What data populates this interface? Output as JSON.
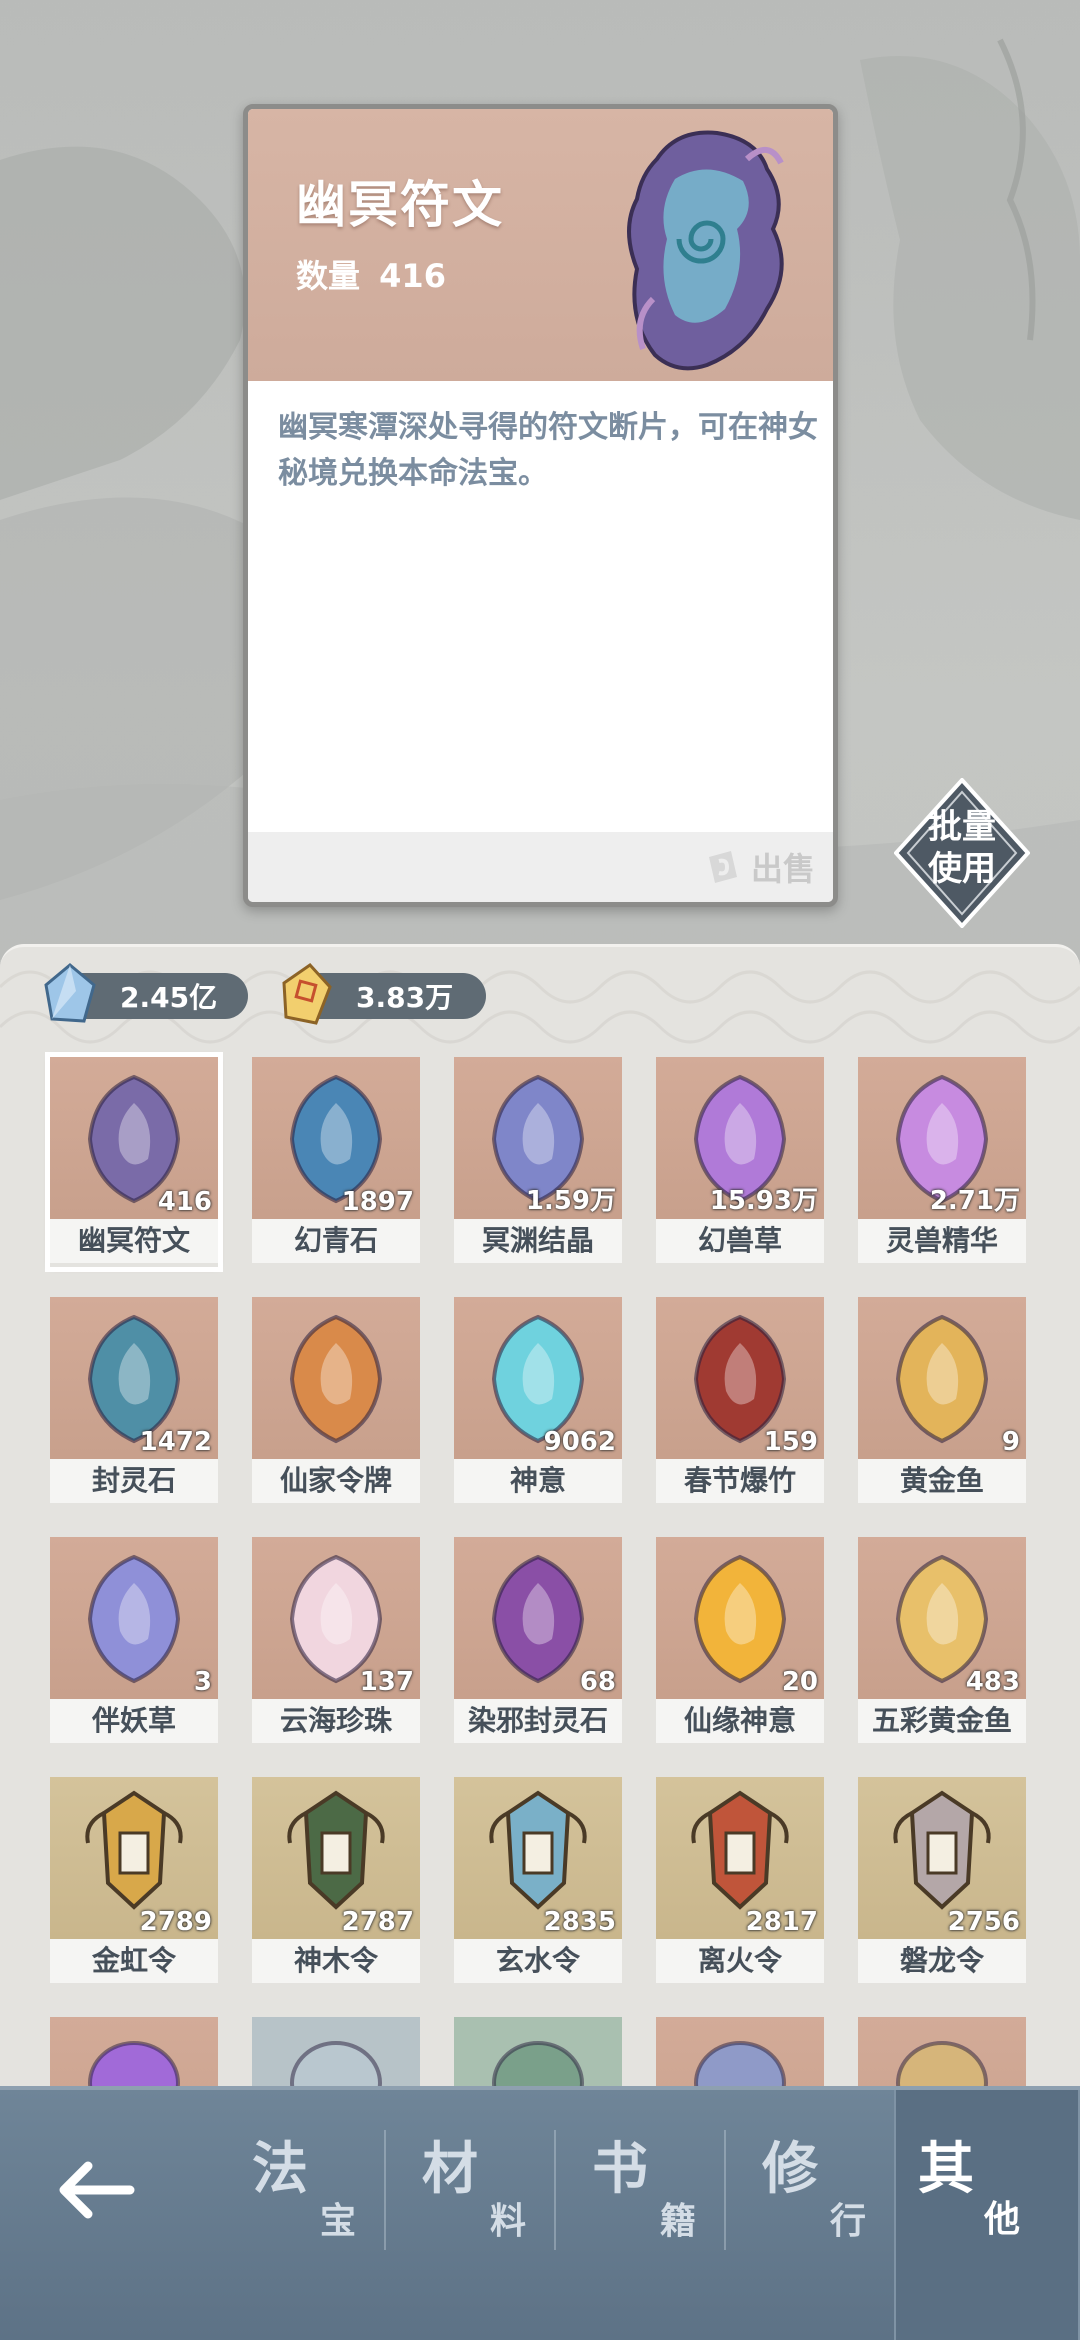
{
  "detail": {
    "title": "幽冥符文",
    "qty_label": "数量",
    "qty_value": "416",
    "description": "幽冥寒潭深处寻得的符文断片，可在神女秘境兑换本命法宝。",
    "sell_label": "出售"
  },
  "batch_use": {
    "line1": "批量",
    "line2": "使用"
  },
  "currency": [
    {
      "icon": "blue-crystal-icon",
      "value": "2.45亿"
    },
    {
      "icon": "gold-crystal-icon",
      "value": "3.83万"
    }
  ],
  "items": [
    {
      "name": "幽冥符文",
      "count": "416",
      "icon": "dark-rune-icon",
      "color": "#7a6ba8",
      "bg": "rose"
    },
    {
      "name": "幻青石",
      "count": "1897",
      "icon": "blue-stone-icon",
      "color": "#4a86b5",
      "bg": "rose"
    },
    {
      "name": "冥渊结晶",
      "count": "1.59万",
      "icon": "crystal-shard-icon",
      "color": "#7f86c9",
      "bg": "rose"
    },
    {
      "name": "幻兽草",
      "count": "15.93万",
      "icon": "purple-herb-icon",
      "color": "#b07ad8",
      "bg": "rose"
    },
    {
      "name": "灵兽精华",
      "count": "2.71万",
      "icon": "purple-orb-icon",
      "color": "#c78be0",
      "bg": "rose"
    },
    {
      "name": "封灵石",
      "count": "1472",
      "icon": "sealed-stone-icon",
      "color": "#4f8fa6",
      "bg": "rose"
    },
    {
      "name": "仙家令牌",
      "count": "",
      "icon": "fairy-token-icon",
      "color": "#d98a4a",
      "bg": "rose"
    },
    {
      "name": "神意",
      "count": "9062",
      "icon": "cyan-flame-icon",
      "color": "#6fd2de",
      "bg": "rose"
    },
    {
      "name": "春节爆竹",
      "count": "159",
      "icon": "firecracker-icon",
      "color": "#a03a32",
      "bg": "rose"
    },
    {
      "name": "黄金鱼",
      "count": "9",
      "icon": "golden-fish-icon",
      "color": "#e3b45a",
      "bg": "rose"
    },
    {
      "name": "伴妖草",
      "count": "3",
      "icon": "blue-herb-icon",
      "color": "#8f90d8",
      "bg": "rose"
    },
    {
      "name": "云海珍珠",
      "count": "137",
      "icon": "pearl-icon",
      "color": "#f1d6df",
      "bg": "rose"
    },
    {
      "name": "染邪封灵石",
      "count": "68",
      "icon": "purple-stone-icon",
      "color": "#8a4fa6",
      "bg": "rose"
    },
    {
      "name": "仙缘神意",
      "count": "20",
      "icon": "gold-flame-icon",
      "color": "#f2b43a",
      "bg": "rose"
    },
    {
      "name": "五彩黄金鱼",
      "count": "483",
      "icon": "rainbow-fish-icon",
      "color": "#e8c06a",
      "bg": "rose"
    },
    {
      "name": "金虹令",
      "count": "2789",
      "icon": "gold-order-icon",
      "color": "#d8a84a",
      "bg": "gold"
    },
    {
      "name": "神木令",
      "count": "2787",
      "icon": "wood-order-icon",
      "color": "#4c6a46",
      "bg": "gold"
    },
    {
      "name": "玄水令",
      "count": "2835",
      "icon": "water-order-icon",
      "color": "#7ab0c8",
      "bg": "gold"
    },
    {
      "name": "离火令",
      "count": "2817",
      "icon": "fire-order-icon",
      "color": "#c0553a",
      "bg": "gold"
    },
    {
      "name": "磐龙令",
      "count": "2756",
      "icon": "dragon-order-icon",
      "color": "#b4a7a8",
      "bg": "gold"
    }
  ],
  "partial_items": [
    {
      "icon": "purple-gem-icon",
      "color": "#a16ad8"
    },
    {
      "icon": "bowl-icon",
      "color": "#b9c7cf"
    },
    {
      "icon": "leaf-icon",
      "color": "#7aa08a"
    },
    {
      "icon": "bag-icon",
      "color": "#8f9ac8"
    },
    {
      "icon": "hammer-orb-icon",
      "color": "#d6b57a"
    }
  ],
  "nav": {
    "back_icon": "back-arrow-icon",
    "tabs": [
      {
        "big": "法",
        "small": "宝",
        "active": false
      },
      {
        "big": "材",
        "small": "料",
        "active": false
      },
      {
        "big": "书",
        "small": "籍",
        "active": false
      },
      {
        "big": "修",
        "small": "行",
        "active": false
      },
      {
        "big": "其",
        "small": "他",
        "active": true
      }
    ]
  }
}
